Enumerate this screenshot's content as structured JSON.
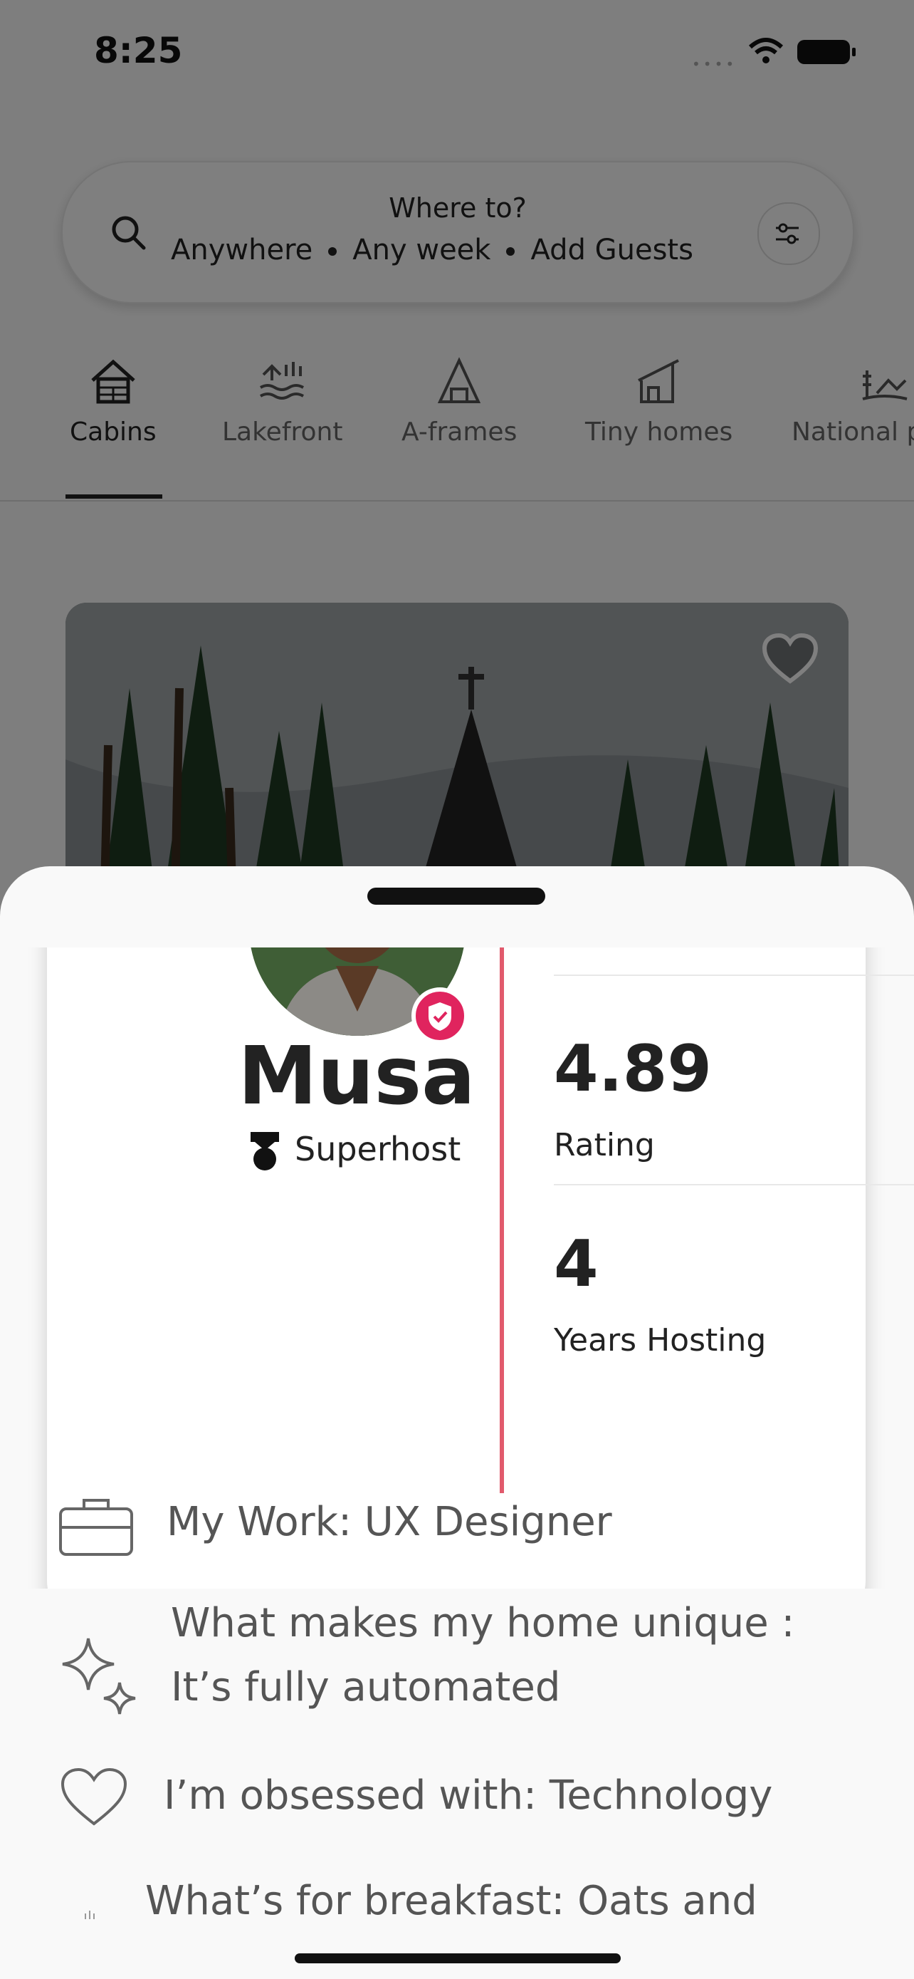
{
  "status_bar": {
    "time": "8:25"
  },
  "search": {
    "title": "Where to?",
    "where": "Anywhere",
    "when": "Any week",
    "guests": "Add Guests"
  },
  "categories": [
    {
      "label": "Cabins",
      "icon": "cabin-icon",
      "selected": true
    },
    {
      "label": "Lakefront",
      "icon": "lakefront-icon",
      "selected": false
    },
    {
      "label": "A-frames",
      "icon": "a-frame-icon",
      "selected": false
    },
    {
      "label": "Tiny homes",
      "icon": "tiny-home-icon",
      "selected": false
    },
    {
      "label": "National p",
      "icon": "national-park-icon",
      "selected": false
    }
  ],
  "listing": {
    "favorite_icon": "heart-icon"
  },
  "host": {
    "name": "Musa",
    "status": "Superhost",
    "verified_icon": "shield-check-icon",
    "stats": [
      {
        "value": "4.89",
        "label": "Rating"
      },
      {
        "value": "4",
        "label": "Years Hosting"
      }
    ]
  },
  "about": [
    {
      "icon": "briefcase-icon",
      "text": "My Work: UX Designer"
    },
    {
      "icon": "sparkles-icon",
      "line1": "What makes my home unique :",
      "line2": "It’s fully automated"
    },
    {
      "icon": "heart-icon",
      "text": "I’m obsessed with: Technology"
    },
    {
      "icon": "breakfast-icon",
      "text": "What’s for breakfast: Oats and"
    }
  ],
  "colors": {
    "accent": "#E0245E",
    "divider_accent": "#E15A6C",
    "text": "#222222"
  }
}
